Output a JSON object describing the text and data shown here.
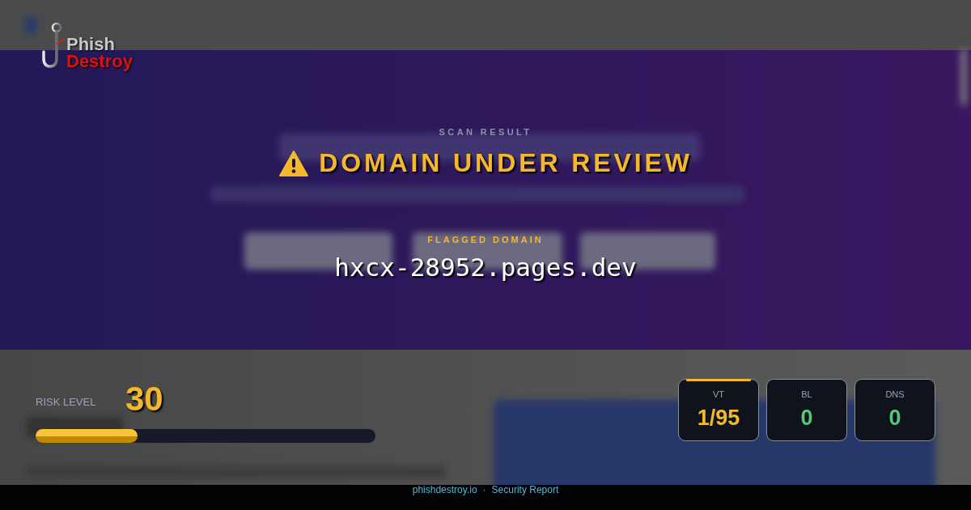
{
  "logo": {
    "line_1": "Phish",
    "line_2": "Destroy"
  },
  "scan": {
    "label": "SCAN RESULT",
    "verdict": "DOMAIN UNDER REVIEW",
    "domain_label": "FLAGGED DOMAIN",
    "domain": "hxcx-28952.pages.dev"
  },
  "risk": {
    "label": "RISK LEVEL",
    "score": "30",
    "level": 0.3
  },
  "stats": [
    {
      "label": "VT",
      "value": "1/95",
      "color": "#f4b82a",
      "alert": true
    },
    {
      "label": "BL",
      "value": "0",
      "color": "#5ac47c",
      "alert": false
    },
    {
      "label": "DNS",
      "value": "0",
      "color": "#5ac47c",
      "alert": false
    }
  ],
  "footer": {
    "site": "phishdestroy.io",
    "separator": "·",
    "page": "Security Report"
  }
}
